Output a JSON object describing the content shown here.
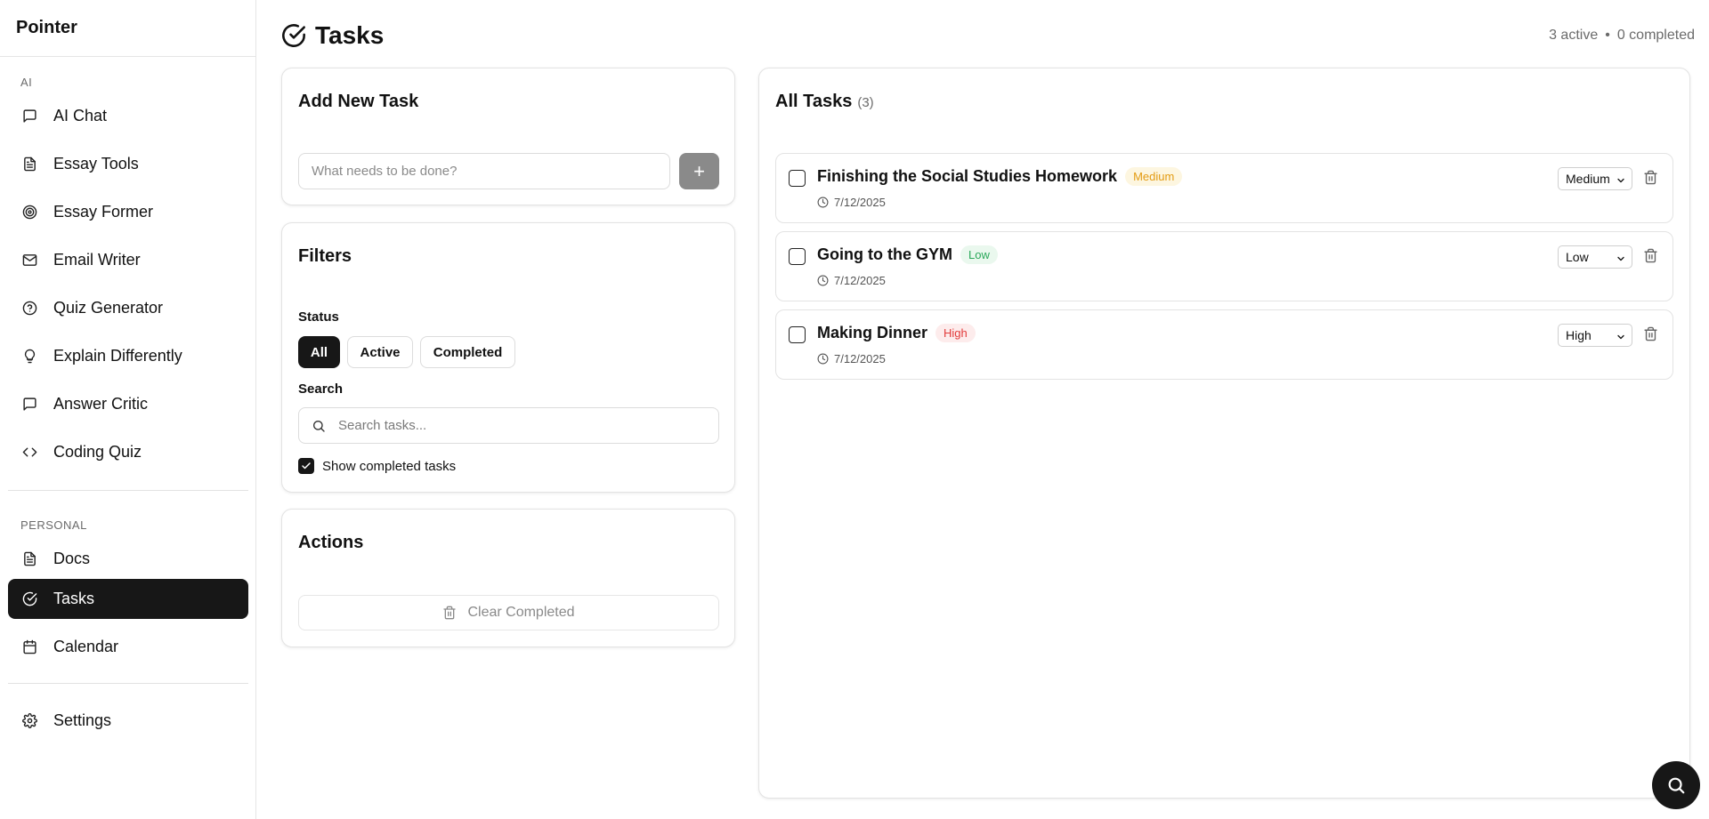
{
  "app": {
    "name": "Pointer"
  },
  "sidebar": {
    "sections": [
      {
        "label": "AI"
      },
      {
        "label": "PERSONAL"
      }
    ],
    "items": [
      {
        "label": "AI Chat",
        "icon": "message-icon"
      },
      {
        "label": "Essay Tools",
        "icon": "document-icon"
      },
      {
        "label": "Essay Former",
        "icon": "target-icon"
      },
      {
        "label": "Email Writer",
        "icon": "mail-icon"
      },
      {
        "label": "Quiz Generator",
        "icon": "help-circle-icon"
      },
      {
        "label": "Explain Differently",
        "icon": "lightbulb-icon"
      },
      {
        "label": "Answer Critic",
        "icon": "message-icon"
      },
      {
        "label": "Coding Quiz",
        "icon": "code-icon"
      },
      {
        "label": "Docs",
        "icon": "document-icon"
      },
      {
        "label": "Tasks",
        "icon": "check-circle-icon",
        "active": true
      },
      {
        "label": "Calendar",
        "icon": "calendar-icon"
      },
      {
        "label": "Settings",
        "icon": "gear-icon"
      }
    ]
  },
  "header": {
    "title": "Tasks",
    "active_count": "3 active",
    "separator": "•",
    "completed_count": "0 completed"
  },
  "add_task": {
    "title": "Add New Task",
    "placeholder": "What needs to be done?",
    "add_label": "+"
  },
  "filters": {
    "title": "Filters",
    "status_label": "Status",
    "status_options": [
      "All",
      "Active",
      "Completed"
    ],
    "selected_status": "All",
    "search_label": "Search",
    "search_placeholder": "Search tasks...",
    "show_completed_label": "Show completed tasks",
    "show_completed": true
  },
  "actions": {
    "title": "Actions",
    "clear_label": "Clear Completed"
  },
  "task_list": {
    "title": "All Tasks",
    "count": "(3)",
    "tasks": [
      {
        "title": "Finishing the Social Studies Homework",
        "priority": "Medium",
        "date": "7/12/2025",
        "completed": false
      },
      {
        "title": "Going to the GYM",
        "priority": "Low",
        "date": "7/12/2025",
        "completed": false
      },
      {
        "title": "Making Dinner",
        "priority": "High",
        "date": "7/12/2025",
        "completed": false
      }
    ]
  },
  "colors": {
    "accent": "#171717",
    "medium": "#e39b12",
    "low": "#2aa85a",
    "high": "#e23b3b"
  }
}
